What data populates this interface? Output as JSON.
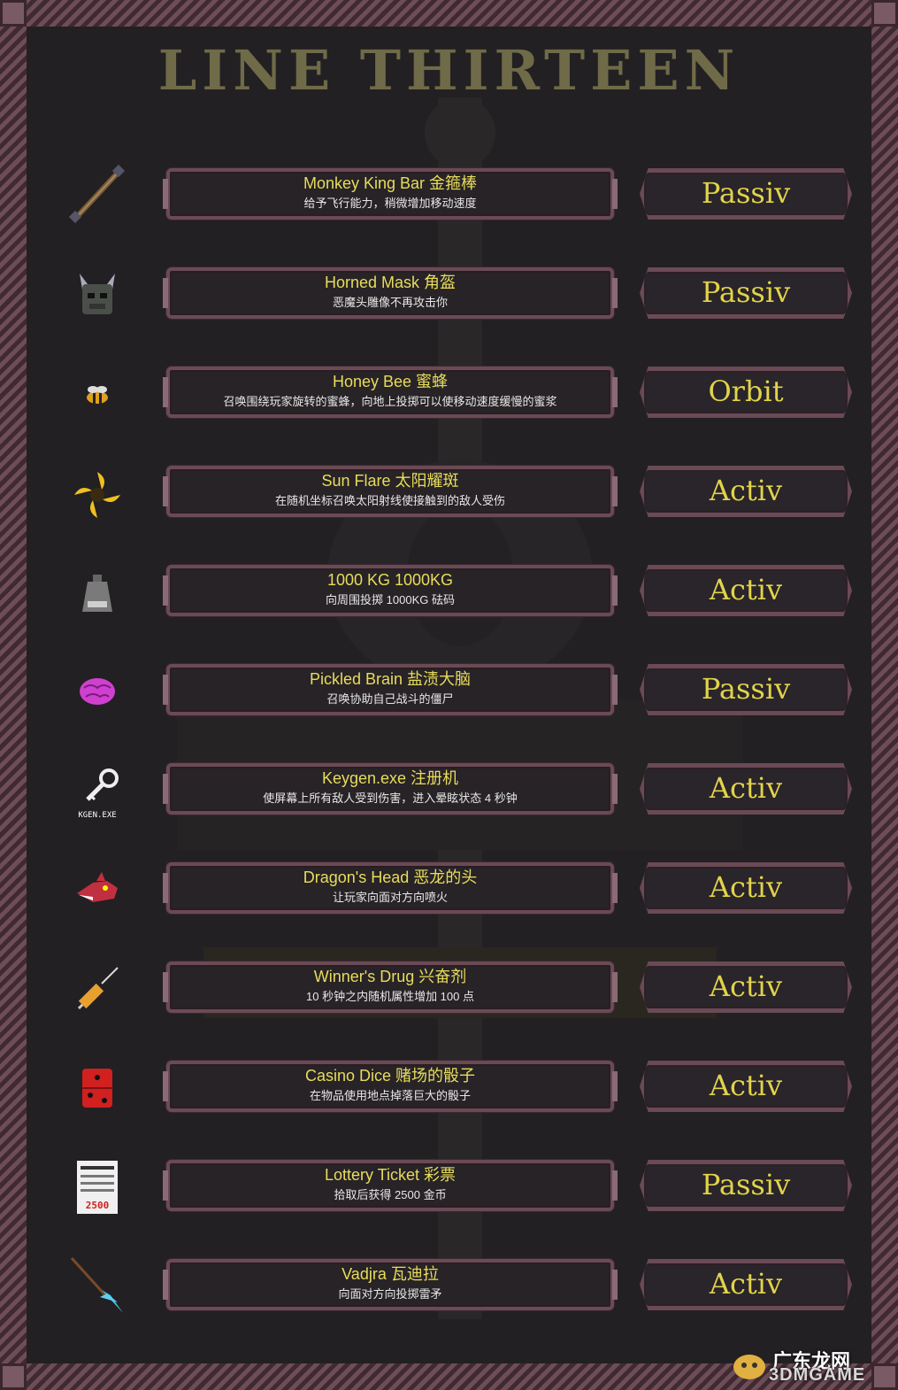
{
  "title": "LINE THIRTEEN",
  "items": [
    {
      "name": "Monkey King Bar 金箍棒",
      "desc": "给予飞行能力，稍微增加移动速度",
      "type": "Passiv",
      "icon": "staff-icon"
    },
    {
      "name": "Horned Mask 角盔",
      "desc": "恶魔头雕像不再攻击你",
      "type": "Passiv",
      "icon": "horned-mask-icon"
    },
    {
      "name": "Honey Bee 蜜蜂",
      "desc": "召唤围绕玩家旋转的蜜蜂，向地上投掷可以使移动速度缓慢的蜜浆",
      "type": "Orbit",
      "icon": "bee-icon"
    },
    {
      "name": "Sun Flare 太阳耀斑",
      "desc": "在随机坐标召唤太阳射线使接触到的敌人受伤",
      "type": "Activ",
      "icon": "sun-flare-icon"
    },
    {
      "name": "1000 KG 1000KG",
      "desc": "向周围投掷 1000KG 砝码",
      "type": "Activ",
      "icon": "weight-icon"
    },
    {
      "name": "Pickled Brain 盐渍大脑",
      "desc": "召唤协助自己战斗的僵尸",
      "type": "Passiv",
      "icon": "brain-icon"
    },
    {
      "name": "Keygen.exe 注册机",
      "desc": "使屏幕上所有敌人受到伤害，进入晕眩状态 4 秒钟",
      "type": "Activ",
      "icon": "key-icon",
      "icon_label": "KGEN.EXE"
    },
    {
      "name": "Dragon's Head 恶龙的头",
      "desc": "让玩家向面对方向喷火",
      "type": "Activ",
      "icon": "dragon-head-icon"
    },
    {
      "name": "Winner's Drug 兴奋剂",
      "desc": "10 秒钟之内随机属性增加 100 点",
      "type": "Activ",
      "icon": "syringe-icon"
    },
    {
      "name": "Casino Dice 赌场的骰子",
      "desc": "在物品使用地点掉落巨大的骰子",
      "type": "Activ",
      "icon": "dice-icon"
    },
    {
      "name": "Lottery Ticket 彩票",
      "desc": "拾取后获得 2500 金币",
      "type": "Passiv",
      "icon": "lottery-ticket-icon",
      "icon_label": "2500"
    },
    {
      "name": "Vadjra 瓦迪拉",
      "desc": "向面对方向投掷雷矛",
      "type": "Activ",
      "icon": "spear-icon"
    }
  ],
  "watermark": {
    "line1": "广东龙网",
    "line2": "3DMGAME"
  }
}
